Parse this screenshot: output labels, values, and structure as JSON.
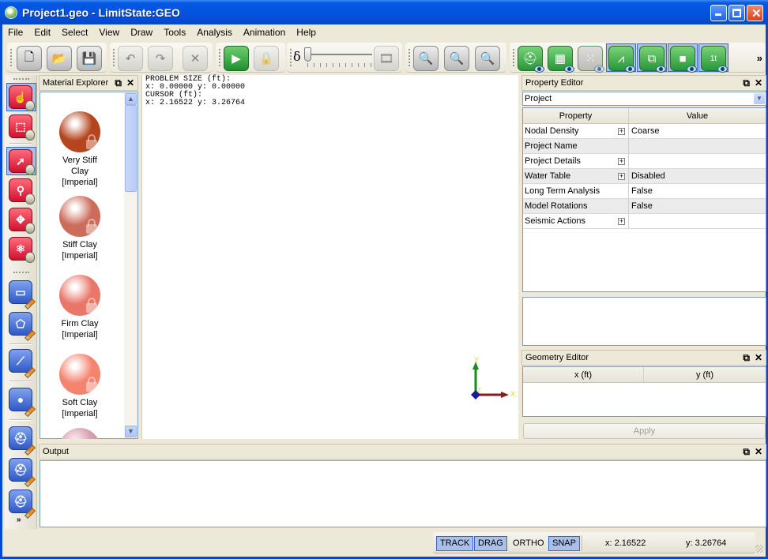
{
  "window": {
    "title": "Project1.geo - LimitState:GEO"
  },
  "menu": [
    "File",
    "Edit",
    "Select",
    "View",
    "Draw",
    "Tools",
    "Analysis",
    "Animation",
    "Help"
  ],
  "toolbar": {
    "file": [
      "new-document",
      "open-folder",
      "save-disk"
    ],
    "edit": [
      "undo",
      "redo",
      "delete"
    ],
    "run": [
      "solve-play",
      "lock"
    ],
    "animation_symbol": "δ",
    "animation_slider_value": 0,
    "zoom": [
      "zoom-fit",
      "zoom-in",
      "zoom-out"
    ],
    "view_toggles": [
      "view-materials",
      "view-grid",
      "view-nodes",
      "view-truss",
      "view-boundaries",
      "view-solids",
      "view-loads"
    ],
    "overflow": "»"
  },
  "material_explorer": {
    "title": "Material Explorer",
    "items": [
      {
        "line1": "Very Stiff",
        "line2": "Clay",
        "line3": "[Imperial]",
        "color": "#b5451f"
      },
      {
        "line1": "Stiff Clay",
        "line2": "[Imperial]",
        "color": "#cc6d5c"
      },
      {
        "line1": "Firm Clay",
        "line2": "[Imperial]",
        "color": "#e8776a"
      },
      {
        "line1": "Soft Clay",
        "line2": "[Imperial]",
        "color": "#f48470"
      }
    ]
  },
  "canvas": {
    "problem_size_label": "PROBLEM SIZE (ft):",
    "problem_size_value": "x: 0.00000 y: 0.00000",
    "cursor_label": "CURSOR (ft):",
    "cursor_value": "x: 2.16522 y: 3.26764",
    "axis_x": "X",
    "axis_y": "Y",
    "axis_z": "Z"
  },
  "property_editor": {
    "title": "Property Editor",
    "selected": "Project",
    "col_property": "Property",
    "col_value": "Value",
    "rows": [
      {
        "name": "Nodal Density",
        "value": "Coarse",
        "expandable": true
      },
      {
        "name": "Project Name",
        "value": "",
        "expandable": false
      },
      {
        "name": "Project Details",
        "value": "",
        "expandable": true
      },
      {
        "name": "Water Table",
        "value": "Disabled",
        "expandable": true
      },
      {
        "name": "Long Term Analysis",
        "value": "False",
        "expandable": false
      },
      {
        "name": "Model Rotations",
        "value": "False",
        "expandable": false
      },
      {
        "name": "Seismic Actions",
        "value": "",
        "expandable": true
      }
    ]
  },
  "geometry_editor": {
    "title": "Geometry Editor",
    "col_x": "x (ft)",
    "col_y": "y (ft)",
    "apply_label": "Apply"
  },
  "output": {
    "title": "Output"
  },
  "status": {
    "track": "TRACK",
    "drag": "DRAG",
    "ortho": "ORTHO",
    "snap": "SNAP",
    "x": "x: 2.16522",
    "y": "y: 3.26764"
  }
}
